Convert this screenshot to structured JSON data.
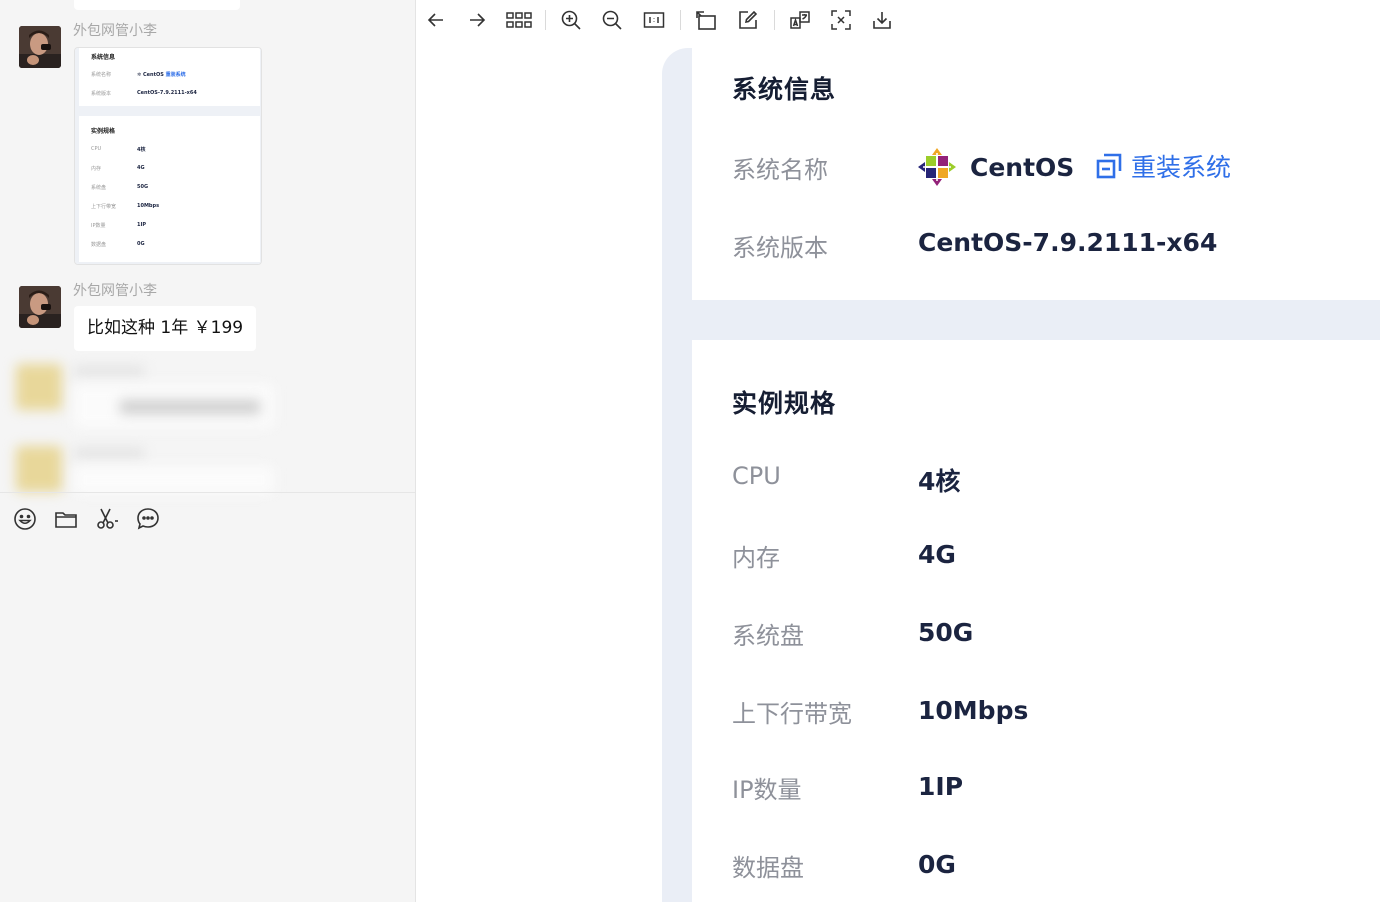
{
  "chat": {
    "messages": [
      {
        "sender": "外包网管小李",
        "type": "image",
        "preview": {
          "sys_title": "系统信息",
          "rows_top": [
            {
              "label": "系统名称",
              "value": "CentOS",
              "action": "重装系统"
            },
            {
              "label": "系统版本",
              "value": "CentOS-7.9.2111-x64"
            }
          ],
          "spec_title": "实例规格",
          "rows_spec": [
            {
              "label": "CPU",
              "value": "4核"
            },
            {
              "label": "内存",
              "value": "4G"
            },
            {
              "label": "系统盘",
              "value": "50G"
            },
            {
              "label": "上下行带宽",
              "value": "10Mbps"
            },
            {
              "label": "IP数量",
              "value": "1IP"
            },
            {
              "label": "数据盘",
              "value": "0G"
            }
          ]
        }
      },
      {
        "sender": "外包网管小李",
        "type": "text",
        "text": "比如这种 1年 ￥199"
      }
    ],
    "toolbar": {
      "icons": [
        "emoji-icon",
        "folder-icon",
        "scissors-icon",
        "chat-bubble-icon"
      ]
    }
  },
  "viewer": {
    "toolbar": {
      "icons": [
        "back-arrow-icon",
        "forward-arrow-icon",
        "grid-icon",
        "zoom-in-icon",
        "zoom-out-icon",
        "actual-size-icon",
        "rotate-icon",
        "edit-icon",
        "translate-icon",
        "extract-text-icon",
        "download-icon"
      ]
    },
    "system_info": {
      "title": "系统信息",
      "name_label": "系统名称",
      "name_value": "CentOS",
      "reinstall_label": "重装系统",
      "version_label": "系统版本",
      "version_value": "CentOS-7.9.2111-x64"
    },
    "spec": {
      "title": "实例规格",
      "rows": [
        {
          "label": "CPU",
          "value": "4核"
        },
        {
          "label": "内存",
          "value": "4G"
        },
        {
          "label": "系统盘",
          "value": "50G"
        },
        {
          "label": "上下行带宽",
          "value": "10Mbps"
        },
        {
          "label": "IP数量",
          "value": "1IP"
        },
        {
          "label": "数据盘",
          "value": "0G"
        }
      ]
    },
    "colors": {
      "accent": "#2f6fe8",
      "value_text": "#1b2440",
      "label_text": "#8e919a",
      "doc_bg": "#eaeef6"
    }
  }
}
